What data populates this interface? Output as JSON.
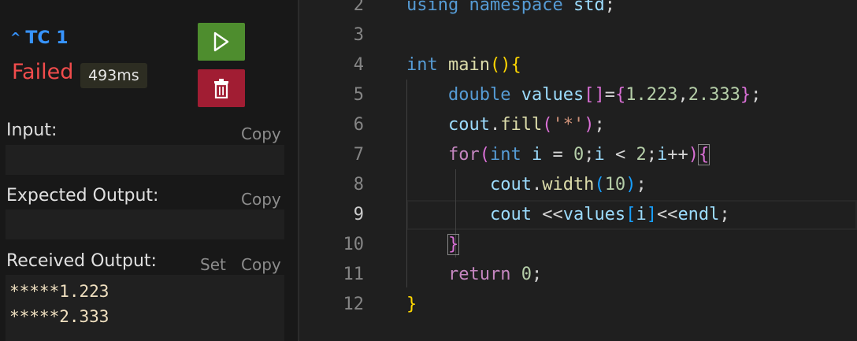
{
  "testcase": {
    "title": "TC 1",
    "status": "Failed",
    "time": "493ms",
    "colors": {
      "failed": "#f14c4c",
      "accent": "#3794ff",
      "run": "#4e8d2e",
      "delete": "#a11d33"
    }
  },
  "panel": {
    "input_label": "Input:",
    "expected_label": "Expected Output:",
    "received_label": "Received Output:",
    "copy_label": "Copy",
    "set_label": "Set",
    "received_lines": [
      "*****1.223",
      "*****2.333"
    ]
  },
  "editor": {
    "line_numbers": [
      "2",
      "3",
      "4",
      "5",
      "6",
      "7",
      "8",
      "9",
      "10",
      "11",
      "12"
    ],
    "active_line": "9",
    "lines": [
      "using namespace std;",
      "",
      "int main(){",
      "    double values[]={1.223,2.333};",
      "    cout.fill('*');",
      "    for(int i = 0;i < 2;i++){",
      "        cout.width(10);",
      "        cout <<values[i]<<endl;",
      "    }",
      "    return 0;",
      "}"
    ]
  }
}
